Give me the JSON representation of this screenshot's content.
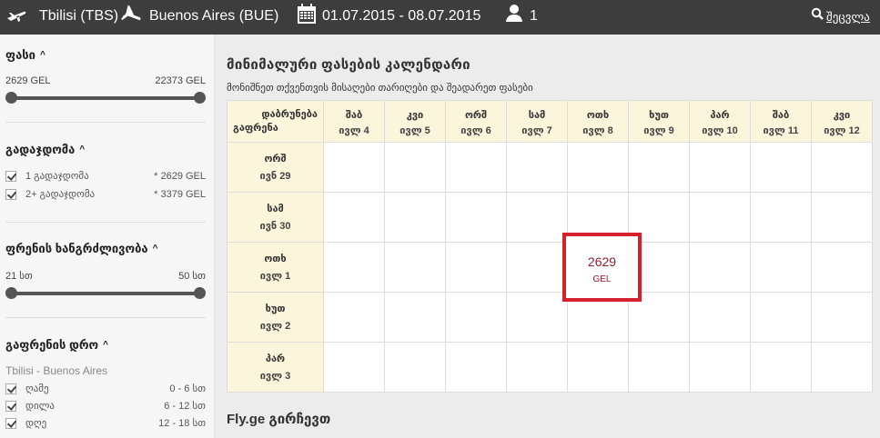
{
  "header": {
    "from": "Tbilisi (TBS) -",
    "to": "Buenos Aires (BUE)",
    "dates": "01.07.2015 - 08.07.2015",
    "passengers": "1",
    "change_label": "შეცვლა"
  },
  "sidebar": {
    "price": {
      "title": "ფასი",
      "min": "2629 GEL",
      "max": "22373 GEL"
    },
    "stops": {
      "title": "გადაჯდომა",
      "items": [
        {
          "label": "1 გადაჯდომა",
          "value": "* 2629 GEL"
        },
        {
          "label": "2+ გადაჯდომა",
          "value": "* 3379 GEL"
        }
      ]
    },
    "duration": {
      "title": "ფრენის ხანგრძლივობა",
      "min": "21 სთ",
      "max": "50 სთ"
    },
    "departure_time": {
      "title": "გაფრენის დრო",
      "route": "Tbilisi - Buenos Aires",
      "items": [
        {
          "label": "ღამე",
          "value": "0 - 6 სთ"
        },
        {
          "label": "დილა",
          "value": "6 - 12 სთ"
        },
        {
          "label": "დღე",
          "value": "12 - 18 სთ"
        }
      ]
    }
  },
  "main": {
    "title": "მინიმალური ფასების კალენდარი",
    "subtitle": "მონიშნეთ თქვენთვის მისაღები თარიღები და შეადარეთ ფასები",
    "corner_return": "დაბრუნება",
    "corner_depart": "გაფრენა",
    "columns": [
      {
        "day": "შაბ",
        "date": "ივლ 4"
      },
      {
        "day": "კვი",
        "date": "ივლ 5"
      },
      {
        "day": "ორშ",
        "date": "ივლ 6"
      },
      {
        "day": "სამ",
        "date": "ივლ 7"
      },
      {
        "day": "ოთხ",
        "date": "ივლ 8"
      },
      {
        "day": "ხუთ",
        "date": "ივლ 9"
      },
      {
        "day": "პარ",
        "date": "ივლ 10"
      },
      {
        "day": "შაბ",
        "date": "ივლ 11"
      },
      {
        "day": "კვი",
        "date": "ივლ 12"
      }
    ],
    "rows": [
      {
        "day": "ორშ",
        "date": "ივნ 29"
      },
      {
        "day": "სამ",
        "date": "ივნ 30"
      },
      {
        "day": "ოთხ",
        "date": "ივლ 1"
      },
      {
        "day": "ხუთ",
        "date": "ივლ 2"
      },
      {
        "day": "პარ",
        "date": "ივლ 3"
      }
    ],
    "price_cell": {
      "amount": "2629",
      "currency": "GEL"
    },
    "footer_title": "Fly.ge გირჩევთ"
  }
}
